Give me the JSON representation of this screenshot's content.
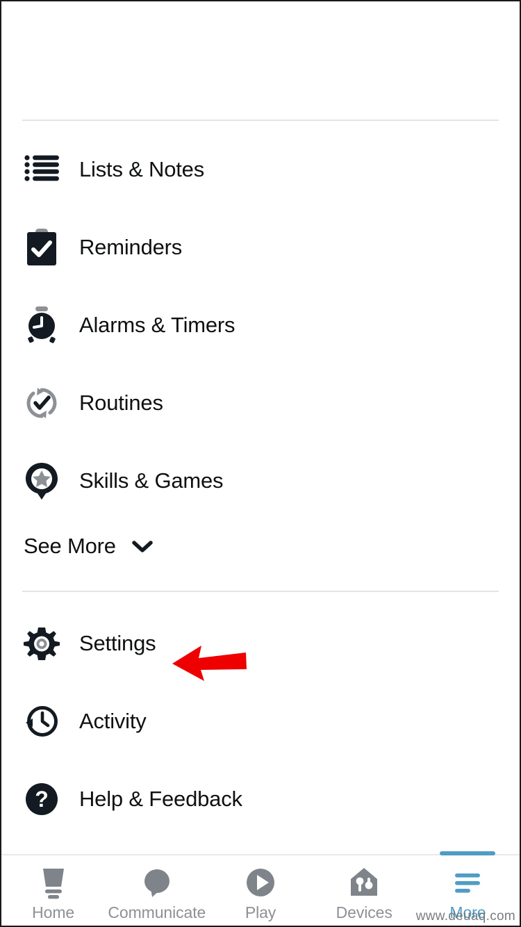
{
  "app": {
    "background_color": "#ffffff",
    "text_color": "#0f1111",
    "divider_color": "#e3e4e6",
    "accent_color": "#4f9dc4",
    "muted_color": "#8d9196",
    "annotation_color": "#ee0000"
  },
  "menu": {
    "primary_items": [
      {
        "label": "Lists & Notes",
        "icon": "list-icon"
      },
      {
        "label": "Reminders",
        "icon": "clipboard-check-icon"
      },
      {
        "label": "Alarms & Timers",
        "icon": "alarm-clock-icon"
      },
      {
        "label": "Routines",
        "icon": "routine-refresh-check-icon"
      },
      {
        "label": "Skills & Games",
        "icon": "pin-star-icon"
      }
    ],
    "see_more": {
      "label": "See More",
      "icon": "chevron-down-icon"
    },
    "secondary_items": [
      {
        "label": "Settings",
        "icon": "gear-icon"
      },
      {
        "label": "Activity",
        "icon": "clock-history-icon"
      },
      {
        "label": "Help & Feedback",
        "icon": "question-circle-icon"
      }
    ]
  },
  "annotation": {
    "type": "red-arrow-left",
    "points_to": "Settings",
    "color": "#ee0000"
  },
  "bottom_nav": {
    "items": [
      {
        "label": "Home",
        "icon": "echo-device-icon",
        "active": false
      },
      {
        "label": "Communicate",
        "icon": "speech-bubble-icon",
        "active": false
      },
      {
        "label": "Play",
        "icon": "play-circle-icon",
        "active": false
      },
      {
        "label": "Devices",
        "icon": "house-devices-icon",
        "active": false
      },
      {
        "label": "More",
        "icon": "hamburger-menu-icon",
        "active": true
      }
    ]
  },
  "watermark": {
    "text": "www.deuaq.com"
  }
}
